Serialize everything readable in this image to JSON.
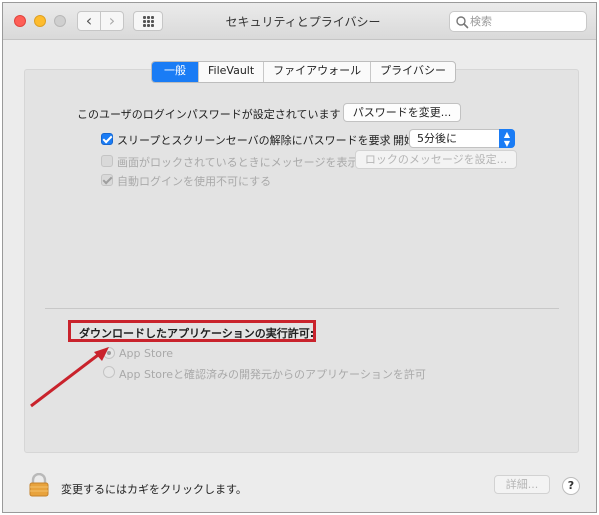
{
  "window": {
    "title": "セキュリティとプライバシー"
  },
  "toolbar": {
    "back_label": "‹",
    "forward_label": "›",
    "search_placeholder": "検索"
  },
  "tabs": [
    {
      "label": "一般",
      "active": true
    },
    {
      "label": "FileVault",
      "active": false
    },
    {
      "label": "ファイアウォール",
      "active": false
    },
    {
      "label": "プライバシー",
      "active": false
    }
  ],
  "general": {
    "password_set_text": "このユーザのログインパスワードが設定されています",
    "change_password_button": "パスワードを変更...",
    "require_password_label": "スリープとスクリーンセーバの解除にパスワードを要求",
    "require_password_checked": true,
    "start_label": "開始後:",
    "start_value": "5分後に",
    "show_message_label": "画面がロックされているときにメッセージを表示",
    "show_message_checked": false,
    "lock_message_button": "ロックのメッセージを設定...",
    "disable_autologin_label": "自動ログインを使用不可にする",
    "disable_autologin_checked": true
  },
  "downloads": {
    "heading": "ダウンロードしたアプリケーションの実行許可:",
    "options": [
      {
        "label": "App Store",
        "selected": true
      },
      {
        "label": "App Storeと確認済みの開発元からのアプリケーションを許可",
        "selected": false
      }
    ]
  },
  "footer": {
    "lock_text": "変更するにはカギをクリックします。",
    "advanced_button": "詳細...",
    "help_label": "?"
  },
  "colors": {
    "accent": "#1a7cf5",
    "highlight_border": "#c9232c",
    "arrow": "#c9232c"
  }
}
